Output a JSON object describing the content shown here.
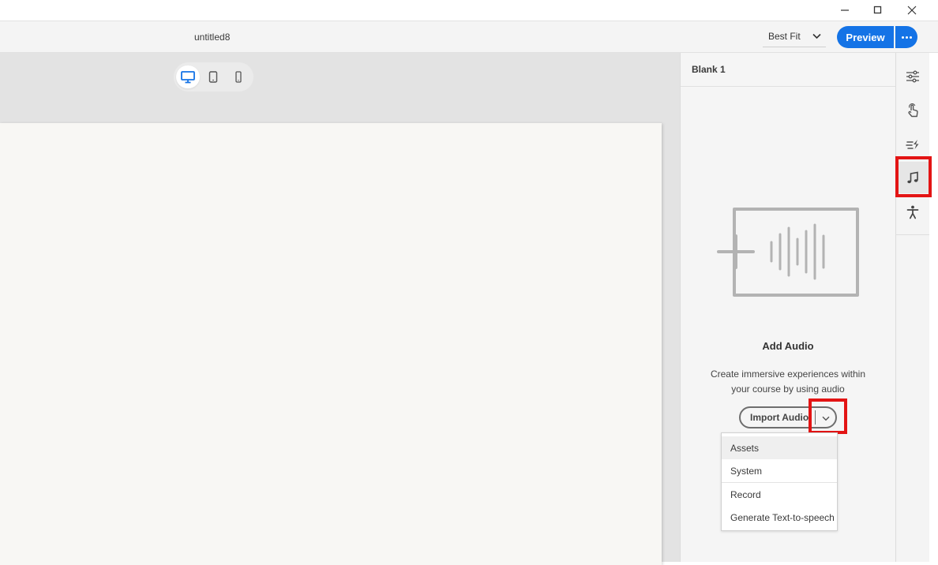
{
  "window": {
    "controls": [
      {
        "name": "minimize",
        "icon": "minimize-icon"
      },
      {
        "name": "maximize",
        "icon": "maximize-icon"
      },
      {
        "name": "close",
        "icon": "close-icon"
      }
    ]
  },
  "header": {
    "doc_title": "untitled8",
    "fit_select": {
      "value": "Best Fit"
    },
    "preview_label": "Preview",
    "more_icon": "more-icon"
  },
  "canvas": {
    "devices": [
      {
        "name": "desktop",
        "icon": "desktop-icon",
        "active": true
      },
      {
        "name": "tablet",
        "icon": "tablet-icon",
        "active": false
      },
      {
        "name": "mobile",
        "icon": "mobile-icon",
        "active": false
      }
    ]
  },
  "panel": {
    "title": "Blank 1",
    "empty_state": {
      "illustration": "add-audio-illustration",
      "title": "Add Audio",
      "description_line1": "Create immersive experiences within",
      "description_line2": "your course by using audio"
    },
    "import_button": {
      "label": "Import Audio"
    },
    "menu": {
      "items": [
        {
          "label": "Assets"
        },
        {
          "label": "System"
        },
        {
          "label": "Record"
        },
        {
          "label": "Generate Text-to-speech"
        }
      ]
    }
  },
  "rail": {
    "items": [
      {
        "name": "properties",
        "icon": "sliders-icon"
      },
      {
        "name": "interactions",
        "icon": "touch-icon"
      },
      {
        "name": "effects",
        "icon": "animation-icon"
      },
      {
        "name": "audio",
        "icon": "music-note-icon",
        "active": true
      },
      {
        "name": "accessibility",
        "icon": "accessibility-icon"
      }
    ]
  },
  "colors": {
    "accent": "#1473e6",
    "highlight": "#e31414",
    "stage": "#f8f7f4",
    "canvas_bg": "#e3e3e3",
    "panel_bg": "#f5f5f5"
  }
}
